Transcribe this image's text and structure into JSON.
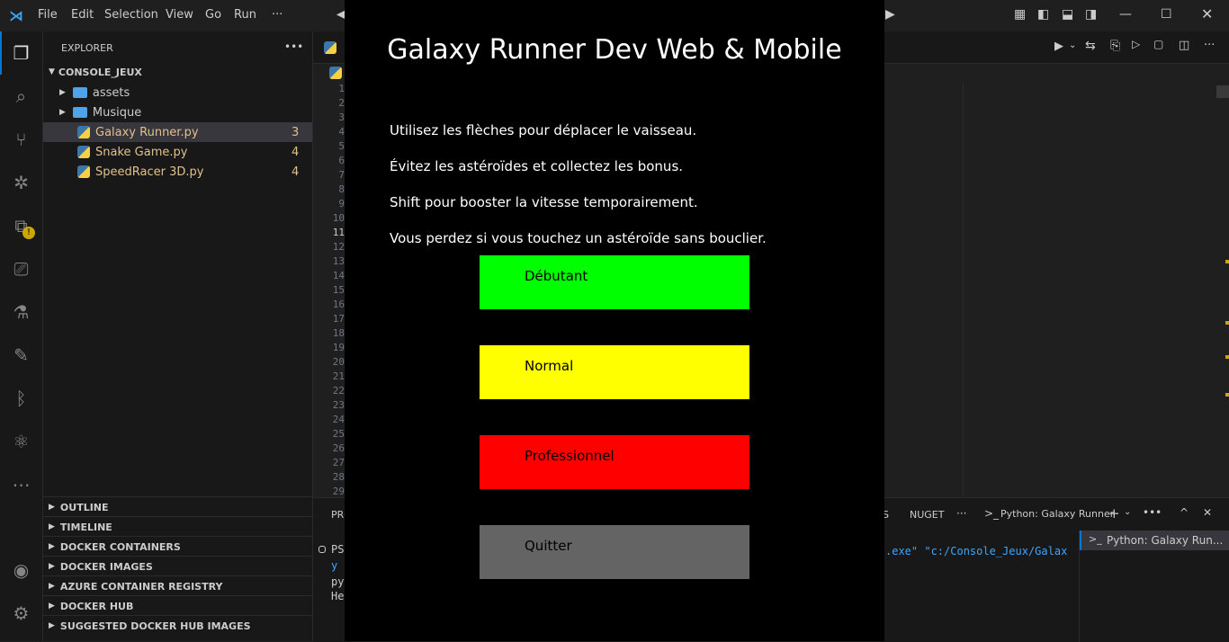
{
  "menu": [
    "File",
    "Edit",
    "Selection",
    "View",
    "Go",
    "Run",
    "···"
  ],
  "explorer": {
    "header": "EXPLORER",
    "more": "•••",
    "root": "CONSOLE_JEUX",
    "folders": [
      "assets",
      "Musique"
    ],
    "files": [
      {
        "name": "Galaxy Runner.py",
        "badge": "3"
      },
      {
        "name": "Snake Game.py",
        "badge": "4"
      },
      {
        "name": "SpeedRacer 3D.py",
        "badge": "4"
      }
    ],
    "sections": [
      "OUTLINE",
      "TIMELINE",
      "DOCKER CONTAINERS",
      "DOCKER IMAGES",
      "AZURE CONTAINER REGISTRY",
      "DOCKER HUB",
      "SUGGESTED DOCKER HUB IMAGES"
    ]
  },
  "editor": {
    "line_numbers": [
      "1",
      "2",
      "3",
      "4",
      "5",
      "6",
      "7",
      "8",
      "9",
      "10",
      "11",
      "12",
      "13",
      "14",
      "15",
      "16",
      "17",
      "18",
      "19",
      "20",
      "21",
      "22",
      "23",
      "24",
      "25",
      "26",
      "27",
      "28",
      "29"
    ]
  },
  "panel": {
    "tab_partial": "PRO",
    "tab_s": "S",
    "nuget": "NUGET",
    "more": "···",
    "terminal_name": "Python: Galaxy Runner",
    "terminal_list_item": "Python: Galaxy Run...",
    "lines": [
      "PS",
      "y",
      "py",
      "He"
    ],
    "cmd_tail": ".exe\" \"c:/Console_Jeux/Galax"
  },
  "game": {
    "title": "Galaxy Runner Dev Web & Mobile",
    "instructions": [
      "Utilisez les flèches pour déplacer le vaisseau.",
      "Évitez les astéroïdes et collectez les bonus.",
      "Shift pour booster la vitesse temporairement.",
      "Vous perdez si vous touchez un astéroïde sans bouclier."
    ],
    "buttons": [
      {
        "label": "Débutant",
        "color": "#00ff00"
      },
      {
        "label": "Normal",
        "color": "#ffff00"
      },
      {
        "label": "Professionnel",
        "color": "#ff0000"
      },
      {
        "label": "Quitter",
        "color": "#646464"
      }
    ]
  },
  "colors": {
    "accent": "#0078d4",
    "warning": "#cca700",
    "file_modified": "#e2c08d"
  }
}
